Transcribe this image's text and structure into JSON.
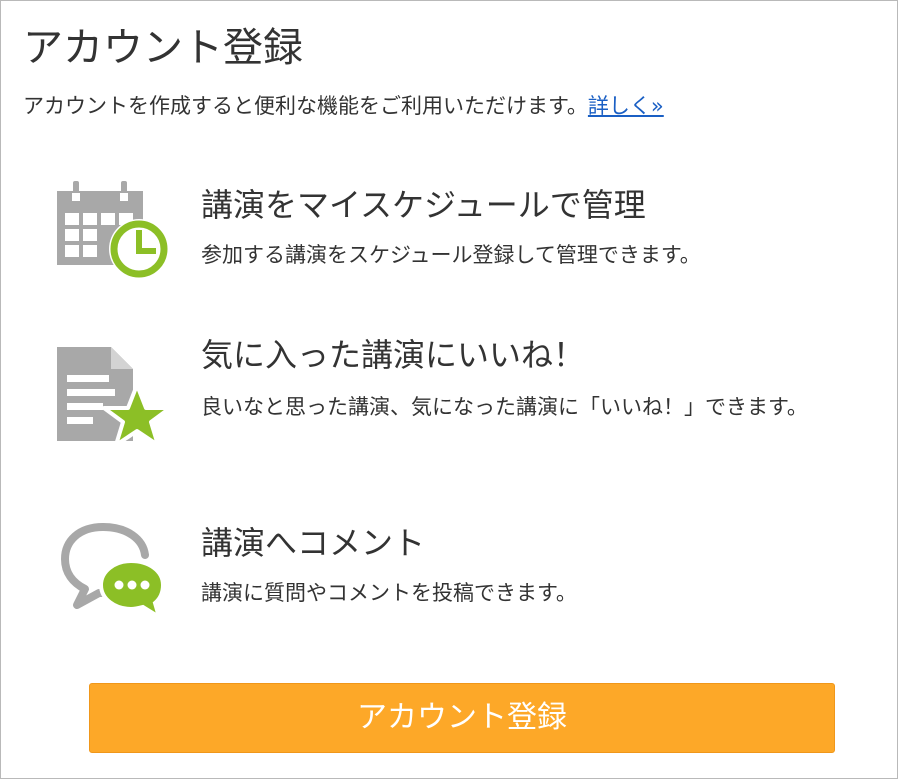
{
  "header": {
    "title": "アカウント登録",
    "intro_text": "アカウントを作成すると便利な機能をご利用いただけます。",
    "details_link": "詳しく»"
  },
  "features": [
    {
      "icon": "calendar-clock-icon",
      "title": "講演をマイスケジュールで管理",
      "description": "参加する講演をスケジュール登録して管理できます。"
    },
    {
      "icon": "document-star-icon",
      "title": "気に入った講演にいいね！",
      "description": "良いなと思った講演、気になった講演に「いいね！」できます。"
    },
    {
      "icon": "comment-bubbles-icon",
      "title": "講演へコメント",
      "description": "講演に質問やコメントを投稿できます。"
    }
  ],
  "register_button": {
    "label": "アカウント登録"
  },
  "colors": {
    "accent_green": "#8cbf26",
    "icon_gray": "#a8a8a8",
    "button_orange": "#fda828",
    "link_blue": "#1a5fc4"
  }
}
